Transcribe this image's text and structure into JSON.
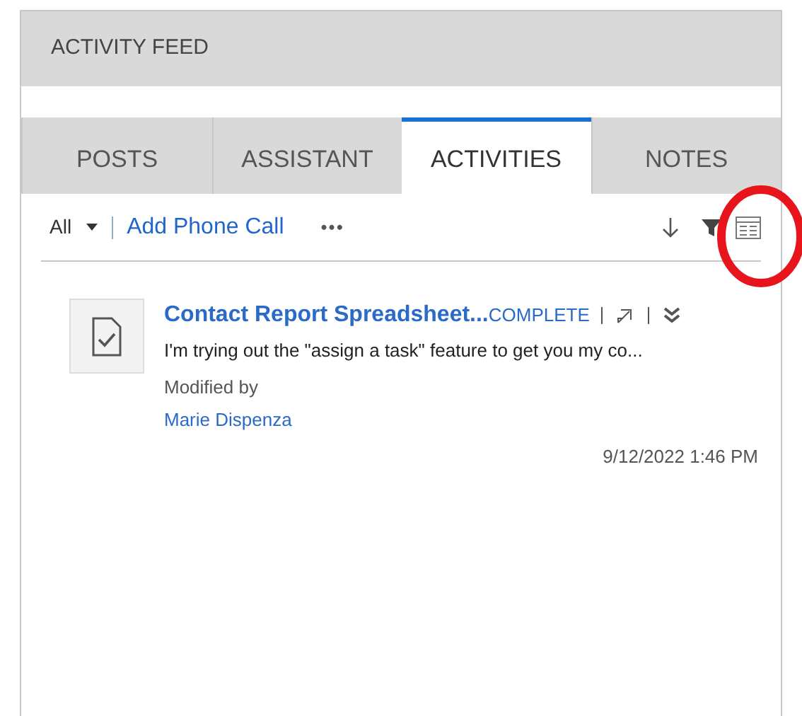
{
  "header": {
    "title": "ACTIVITY FEED"
  },
  "tabs": [
    {
      "label": "POSTS",
      "selected": false
    },
    {
      "label": "ASSISTANT",
      "selected": false
    },
    {
      "label": "ACTIVITIES",
      "selected": true
    },
    {
      "label": "NOTES",
      "selected": false
    }
  ],
  "toolbar": {
    "filter": "All",
    "action": "Add Phone Call",
    "more": "•••"
  },
  "activities": [
    {
      "title": "Contact Report Spreadsheet...",
      "status": "COMPLETE",
      "description": "I'm trying out the \"assign a task\" feature to get you my co...",
      "modified_label": "Modified by",
      "author": "Marie Dispenza",
      "timestamp": "9/12/2022 1:46 PM"
    }
  ]
}
